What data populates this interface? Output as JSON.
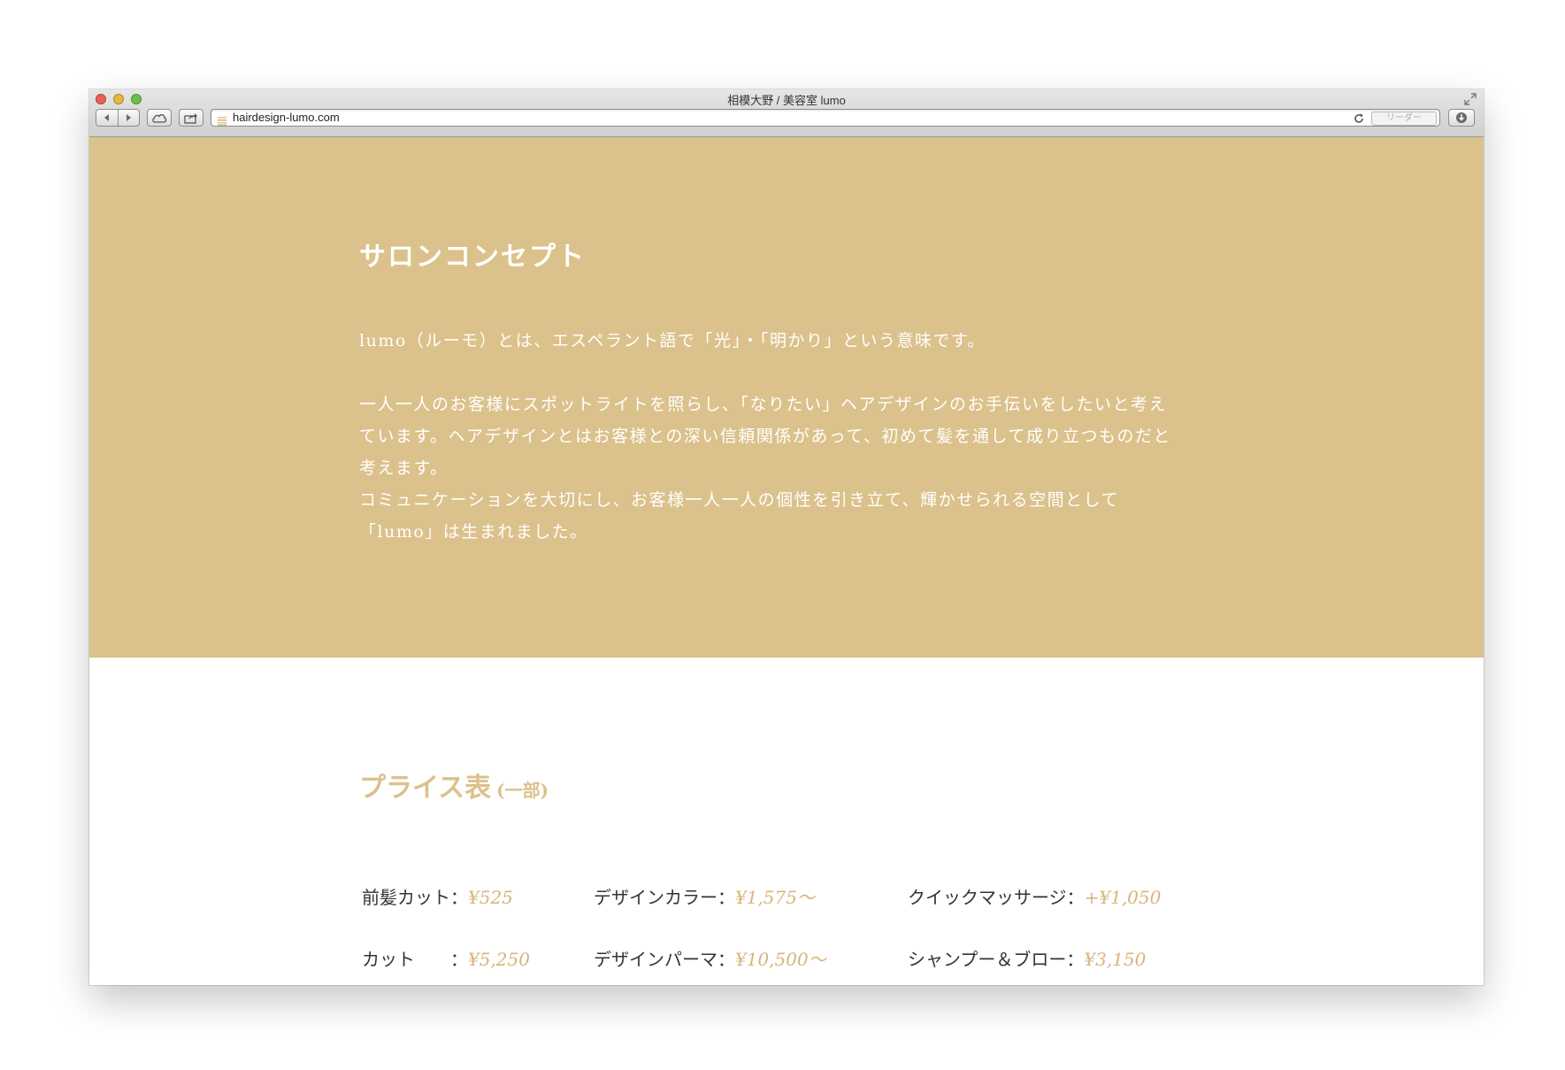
{
  "window": {
    "title": "相模大野 / 美容室 lumo",
    "url": "hairdesign-lumo.com",
    "reader_label": "リーダー"
  },
  "concept": {
    "title": "サロンコンセプト",
    "lines": [
      "lumo（ルーモ）とは、エスペラント語で「光」・「明かり」という意味です。",
      "",
      "一人一人のお客様にスポットライトを照らし、「なりたい」ヘアデザインのお手伝いをしたいと考え",
      "ています。ヘアデザインとはお客様との深い信頼関係があって、初めて髪を通して成り立つものだと",
      "考えます。",
      "コミュニケーションを大切にし、お客様一人一人の個性を引き立て、輝かせられる空間として",
      "「lumo」は生まれました。"
    ]
  },
  "prices": {
    "title": "プライス表",
    "subtitle": "(一部)",
    "rows": [
      [
        {
          "label": "前髪カット：",
          "value": "¥525"
        },
        {
          "label": "デザインカラー：",
          "value": "¥1,575〜"
        },
        {
          "label": "クイックマッサージ：",
          "value": "+¥1,050"
        }
      ],
      [
        {
          "label": "カット　　：",
          "value": "¥5,250"
        },
        {
          "label": "デザインパーマ：",
          "value": "¥10,500〜"
        },
        {
          "label": "シャンプー＆ブロー：",
          "value": "¥3,150"
        }
      ]
    ]
  },
  "colors": {
    "accent": "#dbc18b",
    "price_value": "#d8b47a",
    "text": "#333333"
  },
  "icons": [
    "back-arrow-icon",
    "forward-arrow-icon",
    "icloud-icon",
    "share-icon",
    "reload-icon",
    "download-icon",
    "fullscreen-icon",
    "favicon-icon"
  ]
}
